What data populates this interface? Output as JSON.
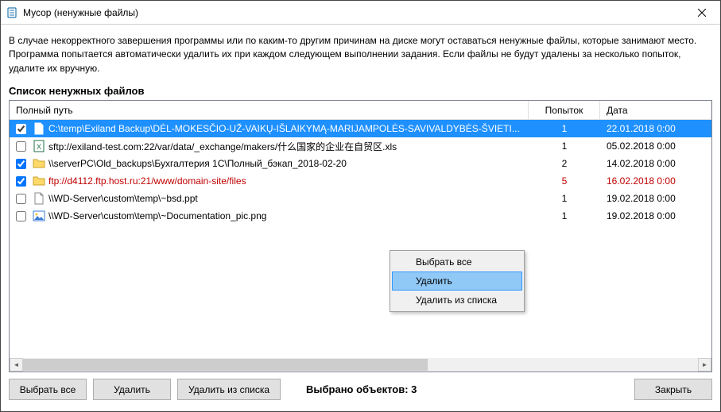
{
  "window": {
    "title": "Мусор (ненужные файлы)"
  },
  "info_text": "В случае некорректного завершения программы или по каким-то другим причинам на диске могут оставаться ненужные файлы, которые занимают место. Программа попытается автоматически удалить их при каждом следующем выполнении задания. Если файлы не будут удалены за несколько попыток, удалите их вручную.",
  "list_label": "Список ненужных файлов",
  "columns": {
    "path": "Полный путь",
    "attempts": "Попыток",
    "date": "Дата"
  },
  "rows": [
    {
      "checked": true,
      "icon": "file",
      "path": "C:\\temp\\Exiland Backup\\DĖL-MOKESČIO-UŽ-VAIKŲ-IŠLAIKYMĄ-MARIJAMPOLĖS-SAVIVALDYBĖS-ŠVIETI...",
      "attempts": "1",
      "date": "22.01.2018  0:00",
      "selected": true,
      "error": false
    },
    {
      "checked": false,
      "icon": "excel",
      "path": "sftp://exiland-test.com:22/var/data/_exchange/makers/什么国家的企业在自贸区.xls",
      "attempts": "1",
      "date": "05.02.2018  0:00",
      "selected": false,
      "error": false
    },
    {
      "checked": true,
      "icon": "folder",
      "path": "\\\\serverPC\\Old_backups\\Бухгалтерия 1С\\Полный_бэкап_2018-02-20",
      "attempts": "2",
      "date": "14.02.2018  0:00",
      "selected": false,
      "error": false
    },
    {
      "checked": true,
      "icon": "folder",
      "path": "ftp://d4112.ftp.host.ru:21/www/domain-site/files",
      "attempts": "5",
      "date": "16.02.2018  0:00",
      "selected": false,
      "error": true
    },
    {
      "checked": false,
      "icon": "file",
      "path": "\\\\WD-Server\\custom\\temp\\~bsd.ppt",
      "attempts": "1",
      "date": "19.02.2018  0:00",
      "selected": false,
      "error": false
    },
    {
      "checked": false,
      "icon": "image",
      "path": "\\\\WD-Server\\custom\\temp\\~Documentation_pic.png",
      "attempts": "1",
      "date": "19.02.2018  0:00",
      "selected": false,
      "error": false
    }
  ],
  "context_menu": {
    "select_all": "Выбрать все",
    "delete": "Удалить",
    "remove_from_list": "Удалить из списка"
  },
  "footer": {
    "select_all": "Выбрать все",
    "delete": "Удалить",
    "remove_from_list": "Удалить из списка",
    "selected_label": "Выбрано объектов: 3",
    "close": "Закрыть"
  }
}
